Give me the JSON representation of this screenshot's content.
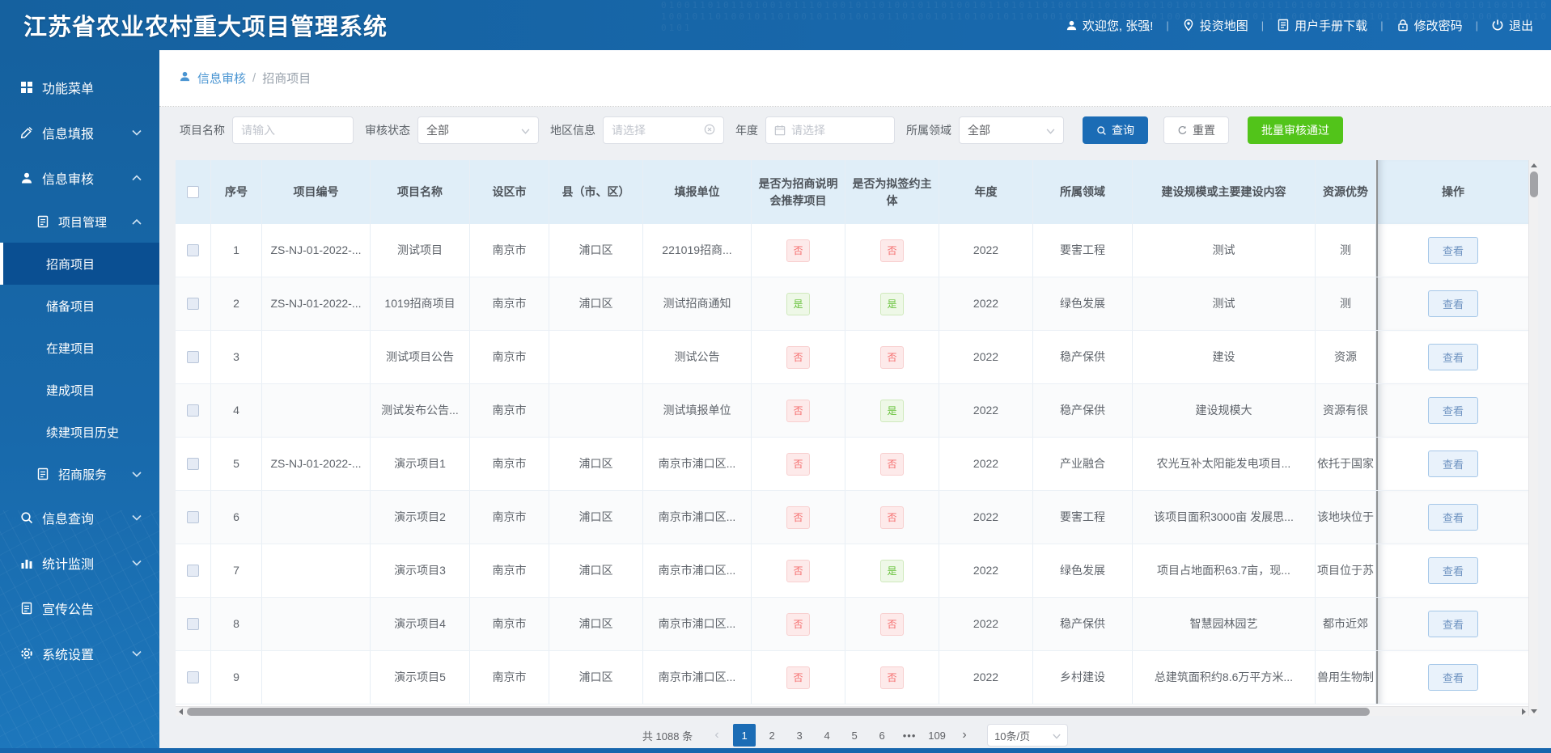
{
  "app": {
    "title": "江苏省农业农村重大项目管理系统",
    "welcome": "欢迎您, 张强!",
    "nav": [
      {
        "name": "nav-invest-map",
        "icon": "map-icon",
        "label": "投资地图"
      },
      {
        "name": "nav-manual-download",
        "icon": "manual-icon",
        "label": "用户手册下载"
      },
      {
        "name": "nav-change-password",
        "icon": "lock-icon",
        "label": "修改密码"
      },
      {
        "name": "nav-logout",
        "icon": "power-icon",
        "label": "退出"
      }
    ]
  },
  "sidebar": {
    "items": [
      {
        "name": "menu-home",
        "label": "功能菜单",
        "icon": "grid-icon",
        "level": 1
      },
      {
        "name": "info-report",
        "label": "信息填报",
        "icon": "pencil-icon",
        "level": 1,
        "chevron": "down"
      },
      {
        "name": "info-review",
        "label": "信息审核",
        "icon": "user-icon",
        "level": 1,
        "chevron": "up"
      },
      {
        "name": "project-management",
        "label": "项目管理",
        "icon": "document-icon",
        "level": 2,
        "chevron": "up"
      },
      {
        "name": "investment-projects",
        "label": "招商项目",
        "level": 3,
        "active": true
      },
      {
        "name": "reserve-projects",
        "label": "储备项目",
        "level": 3
      },
      {
        "name": "under-construction",
        "label": "在建项目",
        "level": 3
      },
      {
        "name": "completed-projects",
        "label": "建成项目",
        "level": 3
      },
      {
        "name": "renewal-project-history",
        "label": "续建项目历史",
        "level": 3
      },
      {
        "name": "investment-services",
        "label": "招商服务",
        "icon": "document-icon",
        "level": 2,
        "chevron": "down"
      },
      {
        "name": "info-query",
        "label": "信息查询",
        "icon": "search-icon",
        "level": 1,
        "chevron": "down"
      },
      {
        "name": "statistics-monitoring",
        "label": "统计监测",
        "icon": "chart-icon",
        "level": 1,
        "chevron": "down"
      },
      {
        "name": "publicity-announcement",
        "label": "宣传公告",
        "icon": "document-icon",
        "level": 1
      },
      {
        "name": "system-settings",
        "label": "系统设置",
        "icon": "gear-icon",
        "level": 1,
        "chevron": "down"
      }
    ]
  },
  "breadcrumb": {
    "root": "信息审核",
    "separator": "/",
    "current": "招商项目"
  },
  "filters": {
    "project_name": {
      "label": "项目名称",
      "placeholder": "请输入"
    },
    "audit_status": {
      "label": "审核状态",
      "value": "全部"
    },
    "region": {
      "label": "地区信息",
      "placeholder": "请选择"
    },
    "year": {
      "label": "年度",
      "placeholder": "请选择"
    },
    "field": {
      "label": "所属领域",
      "value": "全部"
    },
    "search_btn": "查询",
    "reset_btn": "重置",
    "batch_btn": "批量审核通过"
  },
  "table": {
    "columns": [
      "序号",
      "项目编号",
      "项目名称",
      "设区市",
      "县（市、区）",
      "填报单位",
      "是否为招商说明会推荐项目",
      "是否为拟签约主体",
      "年度",
      "所属领域",
      "建设规模或主要建设内容",
      "资源优势",
      "操作"
    ],
    "view_label": "查看",
    "rows": [
      {
        "seq": "1",
        "code": "ZS-NJ-01-2022-...",
        "name": "测试项目",
        "city": "南京市",
        "county": "浦口区",
        "unit": "221019招商...",
        "recommended": "否",
        "proposed": "否",
        "year": "2022",
        "field": "要害工程",
        "content": "测试",
        "resource": "测"
      },
      {
        "seq": "2",
        "code": "ZS-NJ-01-2022-...",
        "name": "1019招商项目",
        "city": "南京市",
        "county": "浦口区",
        "unit": "测试招商通知",
        "recommended": "是",
        "proposed": "是",
        "year": "2022",
        "field": "绿色发展",
        "content": "测试",
        "resource": "测"
      },
      {
        "seq": "3",
        "code": "",
        "name": "测试项目公告",
        "city": "南京市",
        "county": "",
        "unit": "测试公告",
        "recommended": "否",
        "proposed": "否",
        "year": "2022",
        "field": "稳产保供",
        "content": "建设",
        "resource": "资源"
      },
      {
        "seq": "4",
        "code": "",
        "name": "测试发布公告...",
        "city": "南京市",
        "county": "",
        "unit": "测试填报单位",
        "recommended": "否",
        "proposed": "是",
        "year": "2022",
        "field": "稳产保供",
        "content": "建设规模大",
        "resource": "资源有很"
      },
      {
        "seq": "5",
        "code": "ZS-NJ-01-2022-...",
        "name": "演示项目1",
        "city": "南京市",
        "county": "浦口区",
        "unit": "南京市浦口区...",
        "recommended": "否",
        "proposed": "否",
        "year": "2022",
        "field": "产业融合",
        "content": "农光互补太阳能发电项目...",
        "resource": "依托于国家"
      },
      {
        "seq": "6",
        "code": "",
        "name": "演示项目2",
        "city": "南京市",
        "county": "浦口区",
        "unit": "南京市浦口区...",
        "recommended": "否",
        "proposed": "否",
        "year": "2022",
        "field": "要害工程",
        "content": "该项目面积3000亩 发展思...",
        "resource": "该地块位于"
      },
      {
        "seq": "7",
        "code": "",
        "name": "演示项目3",
        "city": "南京市",
        "county": "浦口区",
        "unit": "南京市浦口区...",
        "recommended": "否",
        "proposed": "是",
        "year": "2022",
        "field": "绿色发展",
        "content": "项目占地面积63.7亩，现...",
        "resource": "项目位于苏"
      },
      {
        "seq": "8",
        "code": "",
        "name": "演示项目4",
        "city": "南京市",
        "county": "浦口区",
        "unit": "南京市浦口区...",
        "recommended": "否",
        "proposed": "否",
        "year": "2022",
        "field": "稳产保供",
        "content": "智慧园林园艺",
        "resource": "都市近郊"
      },
      {
        "seq": "9",
        "code": "",
        "name": "演示项目5",
        "city": "南京市",
        "county": "浦口区",
        "unit": "南京市浦口区...",
        "recommended": "否",
        "proposed": "否",
        "year": "2022",
        "field": "乡村建设",
        "content": "总建筑面积约8.6万平方米...",
        "resource": "兽用生物制"
      }
    ]
  },
  "pagination": {
    "total": "共 1088 条",
    "pages": [
      "1",
      "2",
      "3",
      "4",
      "5",
      "6"
    ],
    "active": "1",
    "ellipsis": "•••",
    "last_page": "109",
    "page_size": "10条/页"
  }
}
